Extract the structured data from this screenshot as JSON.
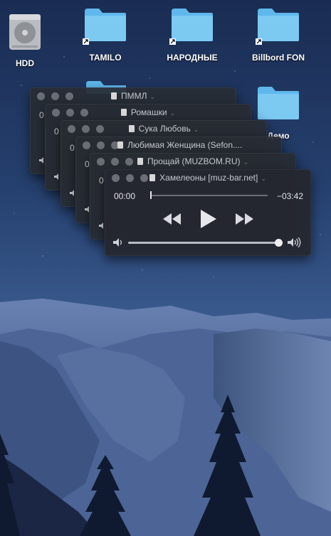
{
  "desktop": {
    "icons": [
      {
        "label": "HDD",
        "type": "hard-drive"
      },
      {
        "label": "TAMILO",
        "type": "folder-alias"
      },
      {
        "label": "НАРОДНЫЕ",
        "type": "folder-alias"
      },
      {
        "label": "Billbord FON",
        "type": "folder-alias"
      },
      {
        "label": "Демо",
        "type": "folder"
      }
    ]
  },
  "players": [
    {
      "title": "ПММЛ",
      "visible_time": "0"
    },
    {
      "title": "Ромашки",
      "visible_time": "0"
    },
    {
      "title": "Сука Любовь",
      "visible_time": "0"
    },
    {
      "title": "Любимая Женщина (Sefon....",
      "visible_time": "0"
    },
    {
      "title": "Прощай (MUZBOM.RU)",
      "visible_time": "0"
    },
    {
      "title": "Хамелеоны [muz-bar.net]",
      "elapsed": "00:00",
      "remaining": "−03:42",
      "playback_progress": 0.0,
      "volume_level": 1.0
    }
  ],
  "icons": {
    "traffic_lights": "window-buttons",
    "document": "document-icon",
    "rewind": "rewind-icon",
    "play": "play-icon",
    "fast_forward": "fast-forward-icon",
    "volume_low": "volume-low-icon",
    "volume_high": "volume-high-icon"
  },
  "colors": {
    "panel": "#282c34",
    "accent_text": "#e3e4e7",
    "folder_blue": "#5fb8ec"
  }
}
